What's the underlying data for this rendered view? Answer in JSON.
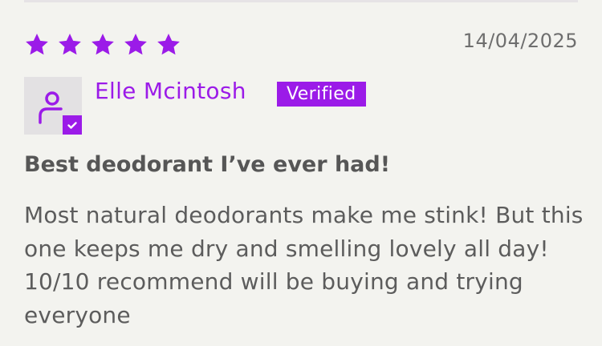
{
  "review": {
    "rating": 5,
    "rating_max": 5,
    "date": "14/04/2025",
    "reviewer": {
      "name": "Elle Mcintosh",
      "badge": "Verified"
    },
    "title": "Best deodorant I’ve ever had!",
    "body": "Most natural deodorants make me stink! But this one keeps me dry and smelling lovely all day! 10/10 recommend will be buying and trying everyone"
  },
  "icons": {
    "star": "star-icon",
    "avatar": "user-icon",
    "verified_check": "check-icon"
  },
  "colors": {
    "accent": "#9b1be8",
    "text": "#5c5c5c",
    "date_text": "#6e6e6e",
    "avatar_bg": "#e3e1e3",
    "background": "#f3f3ef"
  }
}
